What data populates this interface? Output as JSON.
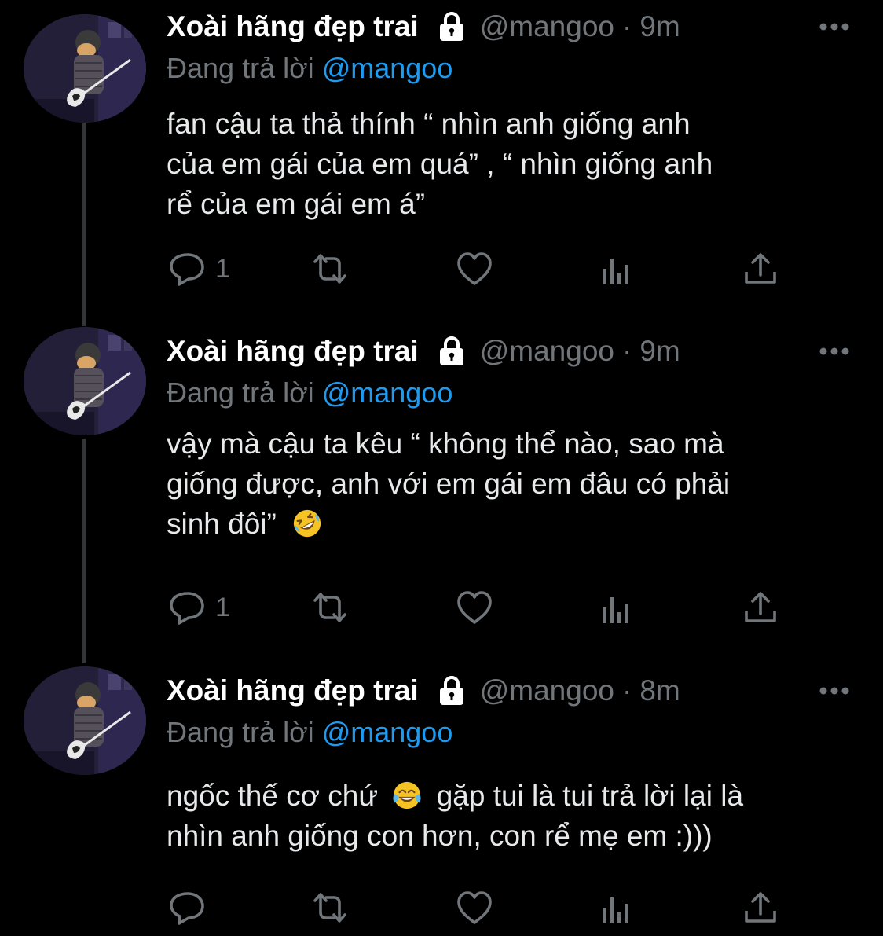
{
  "colors": {
    "background": "#000000",
    "name": "#ffffff",
    "text": "#e7e9ea",
    "secondary": "#71767b",
    "mention": "#1d9bf0",
    "thread_line": "#333639"
  },
  "tweets": [
    {
      "author": "Xoài hãng đẹp trai",
      "verified_icon": "lock-icon",
      "handle": "@mangoo",
      "separator": "·",
      "time": "9m",
      "reply_prefix": "Đang trả lời",
      "reply_mention": "@mangoo",
      "lines": [
        "fan cậu ta thả thính “ nhìn anh giống anh",
        "của em gái của em quá” , “ nhìn giống anh",
        "rể của em gái em á”"
      ],
      "reply_count": "1"
    },
    {
      "author": "Xoài hãng đẹp trai",
      "verified_icon": "lock-icon",
      "handle": "@mangoo",
      "separator": "·",
      "time": "9m",
      "reply_prefix": "Đang trả lời",
      "reply_mention": "@mangoo",
      "lines": [
        "vậy mà cậu ta kêu “ không thể nào, sao mà",
        "giống được, anh với em gái em đâu có phải",
        "sinh đôi”"
      ],
      "emoji": "rolling-on-floor-laughing-emoji",
      "reply_count": "1"
    },
    {
      "author": "Xoài hãng đẹp trai",
      "verified_icon": "lock-icon",
      "handle": "@mangoo",
      "separator": "·",
      "time": "8m",
      "reply_prefix": "Đang trả lời",
      "reply_mention": "@mangoo",
      "line1_before": "ngốc thế cơ chứ",
      "line1_after": "gặp tui là tui trả lời lại là",
      "lines": [
        "nhìn anh giống con hơn, con rể mẹ em :)))"
      ],
      "emoji": "tears-of-joy-emoji",
      "reply_count": ""
    }
  ],
  "action_icons": [
    "reply-icon",
    "retweet-icon",
    "like-icon",
    "views-icon",
    "share-icon"
  ]
}
